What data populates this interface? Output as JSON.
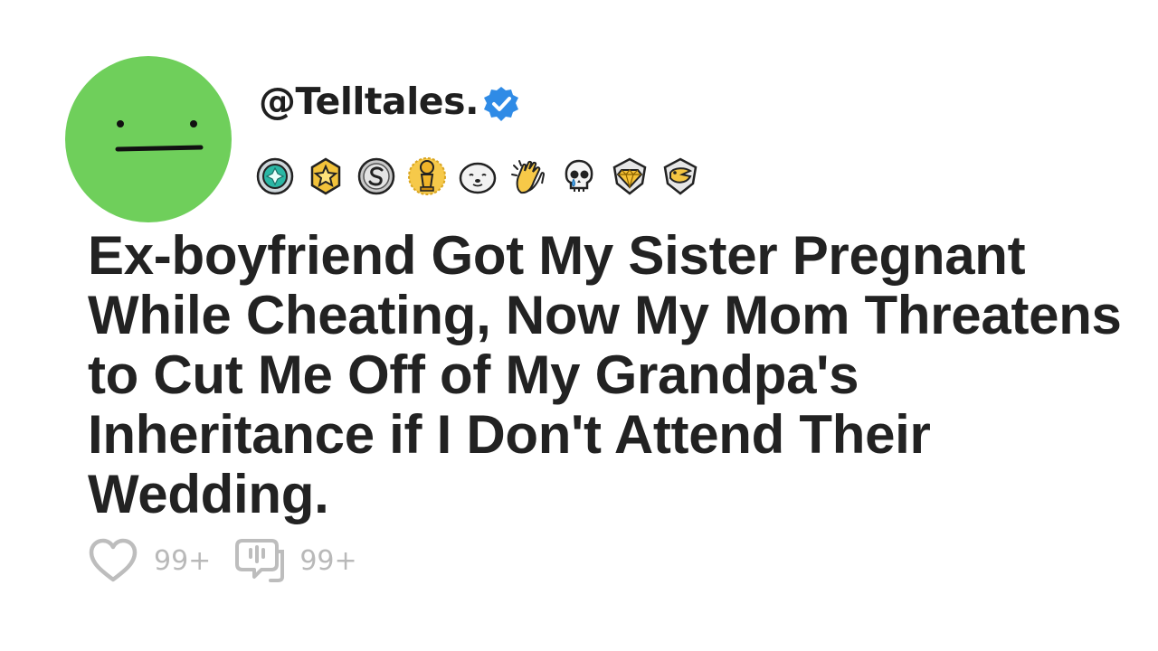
{
  "post": {
    "username": "@Telltales.",
    "verified_icon": "verified-check-icon",
    "verified_color": "#2f8be6",
    "avatar_color": "#6fcf5b",
    "awards": [
      "teal-gem-award-icon",
      "gold-star-award-icon",
      "silver-s-coin-award-icon",
      "gold-trophy-award-icon",
      "seal-face-award-icon",
      "clapping-hands-award-icon",
      "crying-skull-award-icon",
      "gold-diamond-award-icon",
      "eagle-shield-award-icon"
    ],
    "title": "Ex-boyfriend Got My Sister Pregnant While Cheating, Now My Mom Threatens to Cut Me Off of My Grandpa's Inheritance if I Don't Attend Their Wedding.",
    "likes": "99+",
    "comments": "99+"
  }
}
